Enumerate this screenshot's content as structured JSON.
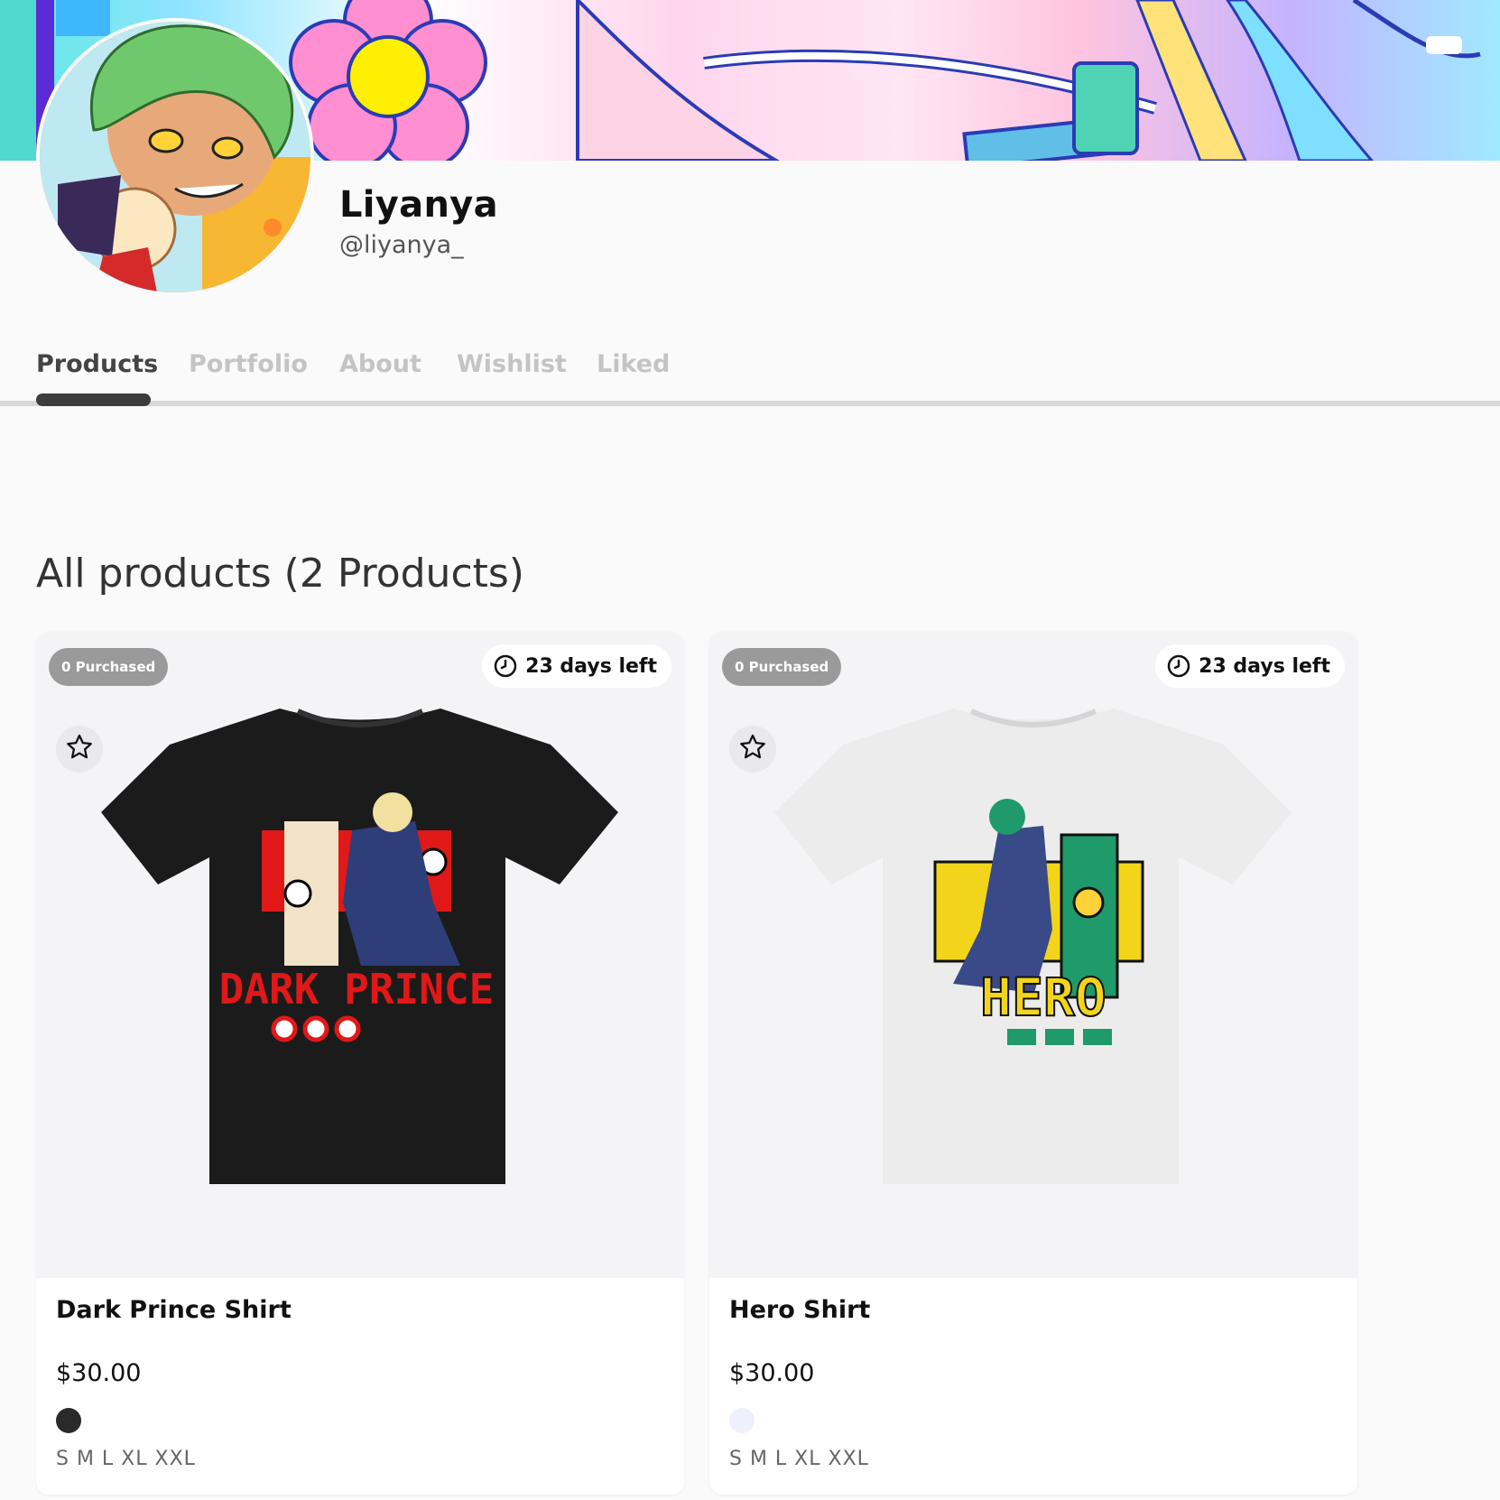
{
  "profile": {
    "display_name": "Liyanya",
    "handle": "@liyanya_"
  },
  "tabs": [
    {
      "label": "Products",
      "active": true
    },
    {
      "label": "Portfolio",
      "active": false
    },
    {
      "label": "About",
      "active": false
    },
    {
      "label": "Wishlist",
      "active": false
    },
    {
      "label": "Liked",
      "active": false
    }
  ],
  "section": {
    "title": "All products (2 Products)"
  },
  "products": [
    {
      "name": "Dark Prince Shirt",
      "price": "$30.00",
      "purchased": "0 Purchased",
      "days_left": "23 days left",
      "swatch_color": "#2a2a2a",
      "sizes": "S M L XL XXL",
      "shirt_color": "#1b1b1b",
      "print_text": "DARK PRINCE",
      "print_color": "#e01818"
    },
    {
      "name": "Hero Shirt",
      "price": "$30.00",
      "purchased": "0 Purchased",
      "days_left": "23 days left",
      "swatch_color": "#eef0fb",
      "sizes": "S M L XL XXL",
      "shirt_color": "#ececec",
      "print_text": "HERO",
      "print_color": "#f2d51a"
    }
  ],
  "icons": {
    "clock": "clock-icon",
    "favorite": "star-outline-icon"
  }
}
